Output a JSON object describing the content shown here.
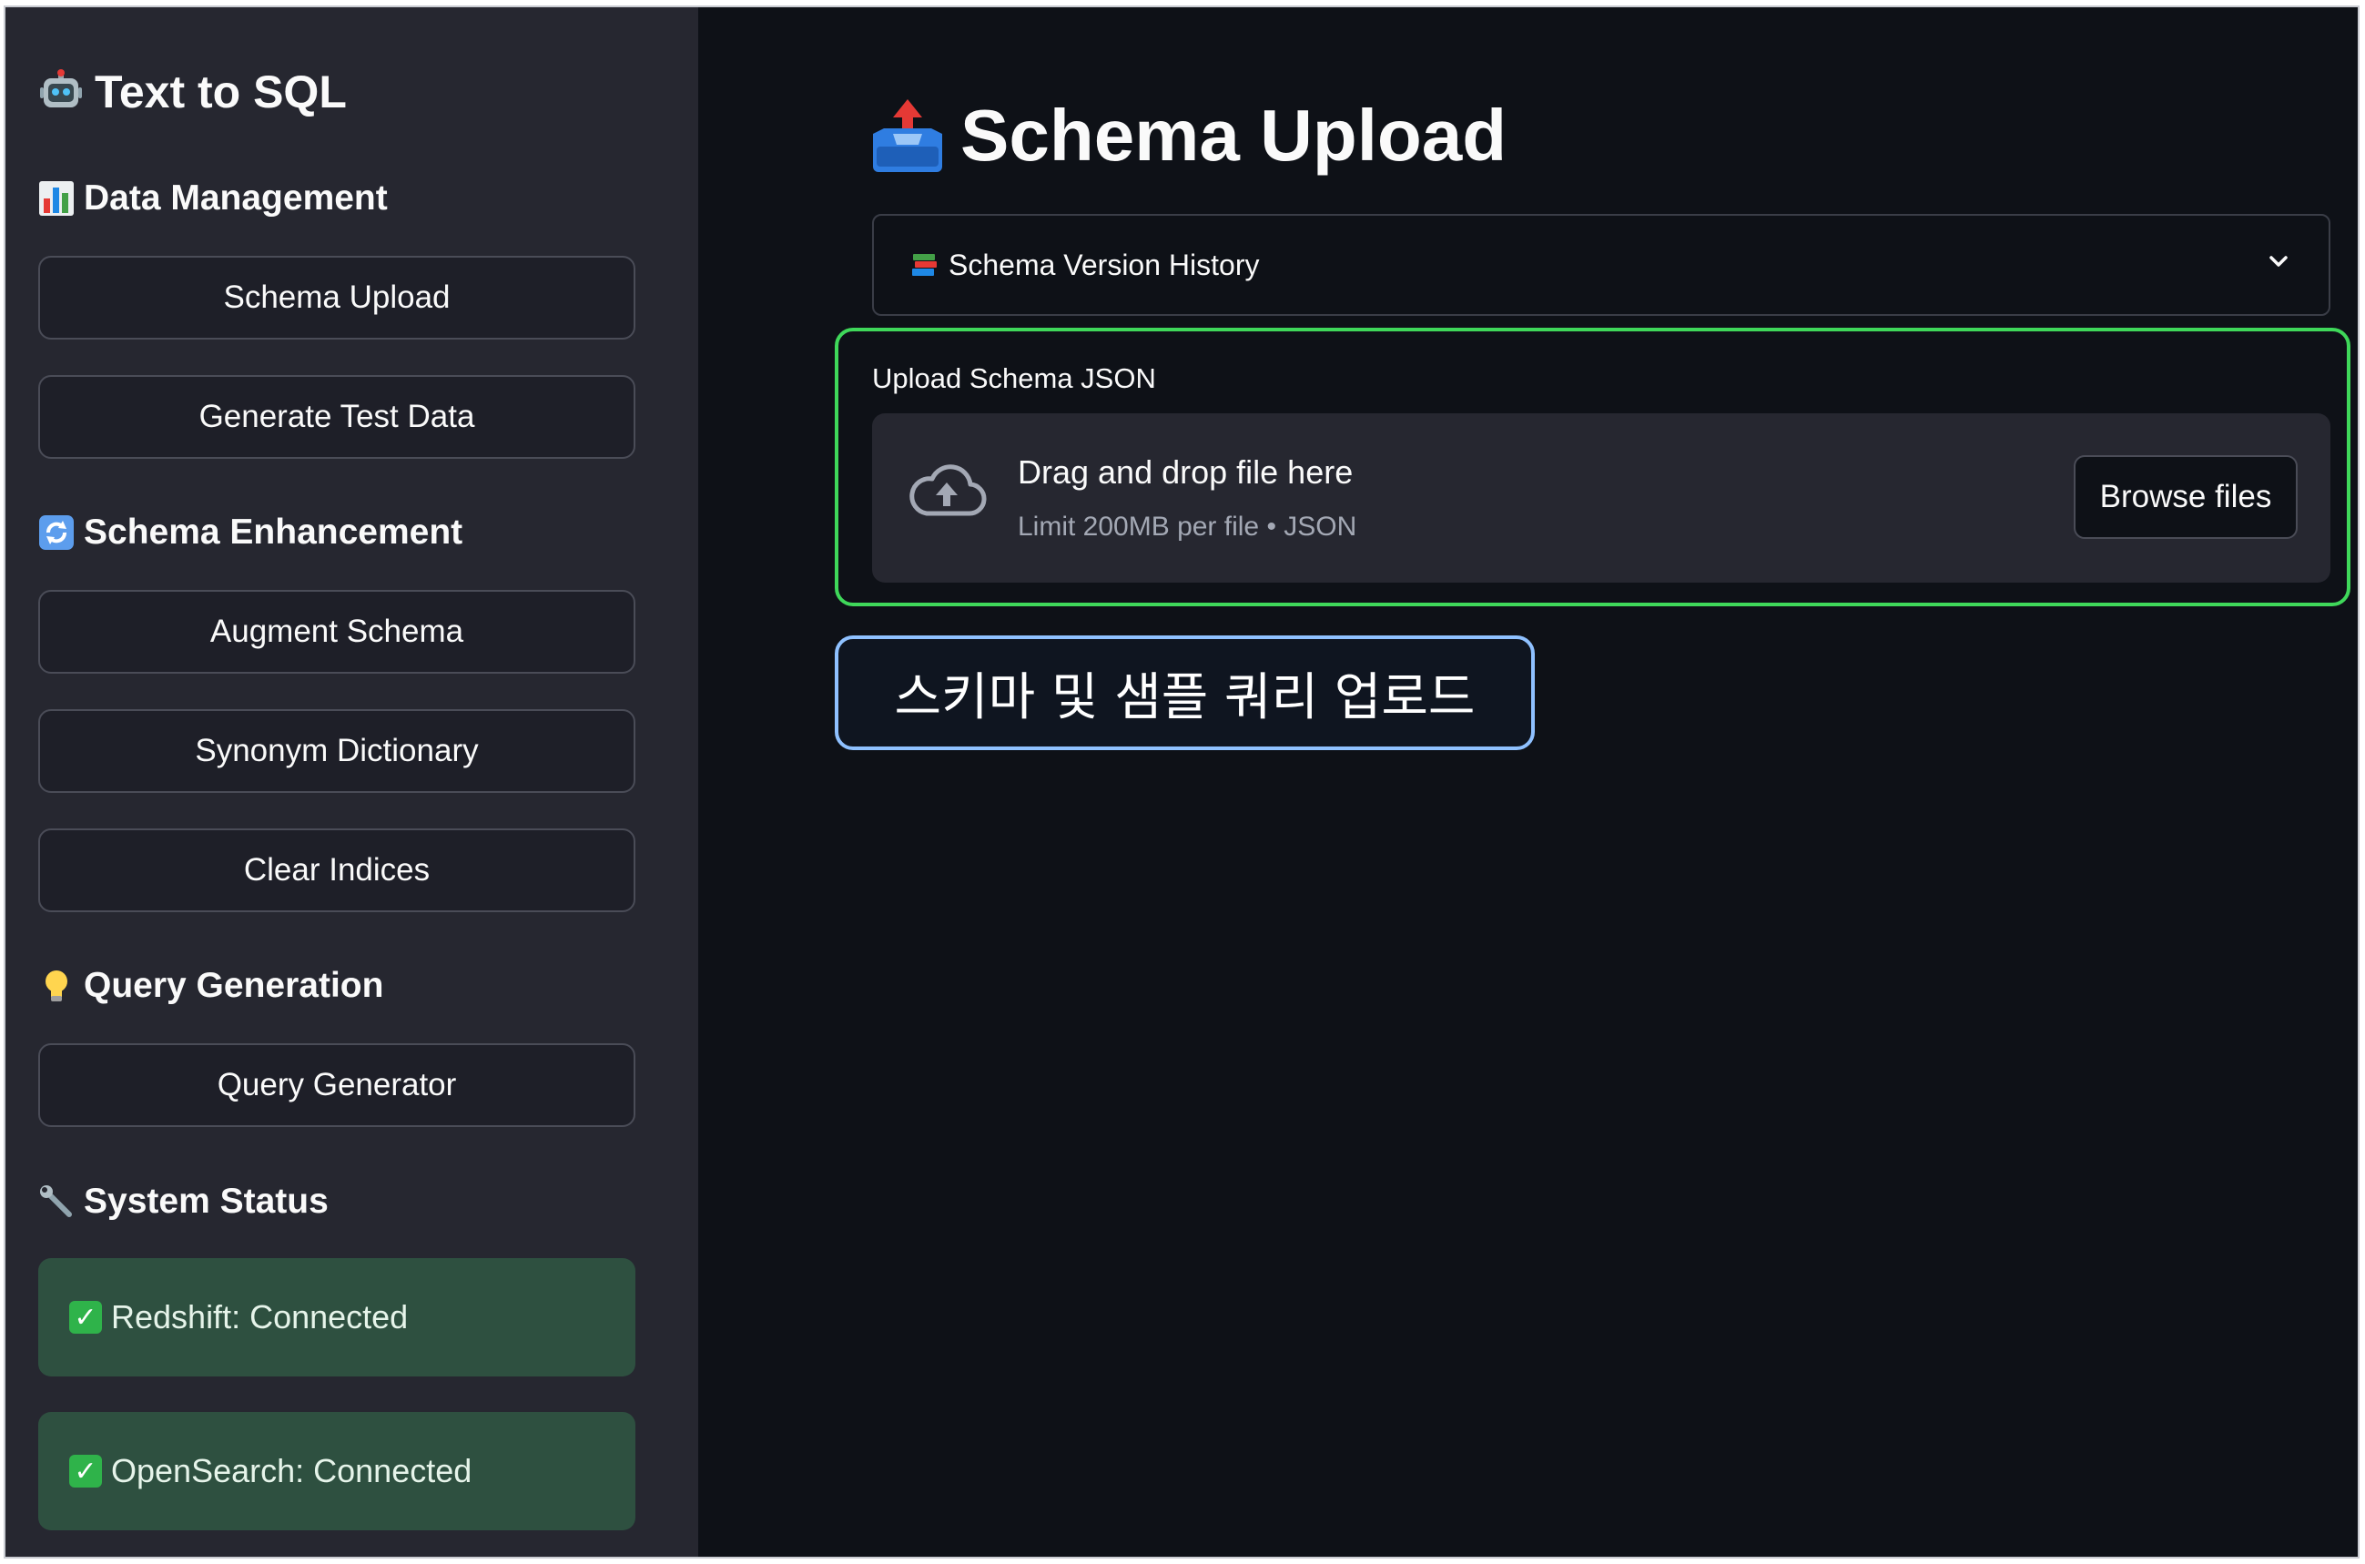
{
  "sidebar": {
    "app_title": "Text to SQL",
    "sections": {
      "data_management": "Data Management",
      "schema_enhancement": "Schema Enhancement",
      "query_generation": "Query Generation",
      "system_status": "System Status"
    },
    "buttons": {
      "schema_upload": "Schema Upload",
      "generate_test_data": "Generate Test Data",
      "augment_schema": "Augment Schema",
      "synonym_dictionary": "Synonym Dictionary",
      "clear_indices": "Clear Indices",
      "query_generator": "Query Generator"
    },
    "status": {
      "redshift": "Redshift: Connected",
      "opensearch": "OpenSearch: Connected"
    },
    "icons": {
      "app": "robot-icon",
      "data_management": "bar-chart-icon",
      "schema_enhancement": "refresh-icon",
      "query_generation": "lightbulb-icon",
      "system_status": "wrench-icon",
      "status_ok": "check-icon"
    }
  },
  "main": {
    "page_title": "Schema Upload",
    "page_title_icon": "outbox-tray-icon",
    "expander": {
      "label": "Schema Version History",
      "icon": "books-icon"
    },
    "uploader": {
      "label": "Upload Schema JSON",
      "drag_text": "Drag and drop file here",
      "limit_text": "Limit 200MB per file • JSON",
      "browse_label": "Browse files"
    },
    "callout_text": "스키마 및 샘플 쿼리 업로드"
  },
  "colors": {
    "sidebar_bg": "#262730",
    "main_bg": "#0e1117",
    "highlight_border": "#3fd85a",
    "callout_border": "#8fc1ff",
    "status_bg": "#2e5040"
  }
}
